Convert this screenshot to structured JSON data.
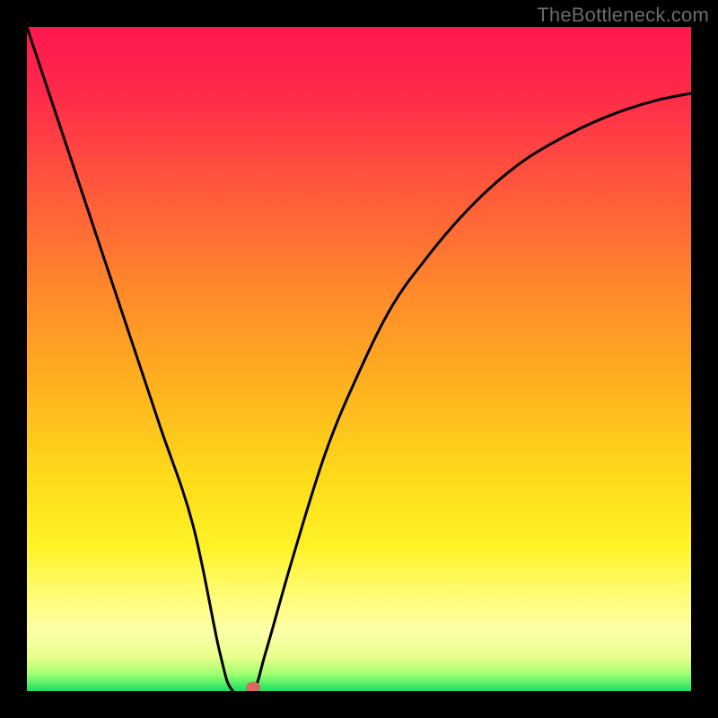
{
  "watermark": "TheBottleneck.com",
  "chart_data": {
    "type": "line",
    "title": "",
    "xlabel": "",
    "ylabel": "",
    "xlim": [
      0,
      100
    ],
    "ylim": [
      0,
      100
    ],
    "grid": false,
    "series": [
      {
        "name": "curve",
        "x": [
          0,
          5,
          10,
          15,
          20,
          25,
          29,
          31,
          34,
          36,
          40,
          45,
          50,
          55,
          60,
          65,
          70,
          75,
          80,
          85,
          90,
          95,
          100
        ],
        "values": [
          100,
          85,
          70,
          55,
          40,
          25,
          6,
          0,
          0,
          6,
          20,
          36,
          48,
          58,
          65,
          71,
          76,
          80,
          83,
          85.5,
          87.5,
          89,
          90
        ]
      }
    ],
    "marker": {
      "x": 34,
      "y": 0.5
    },
    "gradient_stops": [
      {
        "pos": 0,
        "color": "#ff1750"
      },
      {
        "pos": 10,
        "color": "#ff2a4a"
      },
      {
        "pos": 25,
        "color": "#ff5a3b"
      },
      {
        "pos": 40,
        "color": "#ff8a2a"
      },
      {
        "pos": 55,
        "color": "#ffb41f"
      },
      {
        "pos": 68,
        "color": "#ffdb1a"
      },
      {
        "pos": 78,
        "color": "#fff225"
      },
      {
        "pos": 86,
        "color": "#fffd7a"
      },
      {
        "pos": 91,
        "color": "#fdffa8"
      },
      {
        "pos": 95,
        "color": "#e6ff8a"
      },
      {
        "pos": 97.5,
        "color": "#9dff70"
      },
      {
        "pos": 100,
        "color": "#18e060"
      }
    ]
  }
}
